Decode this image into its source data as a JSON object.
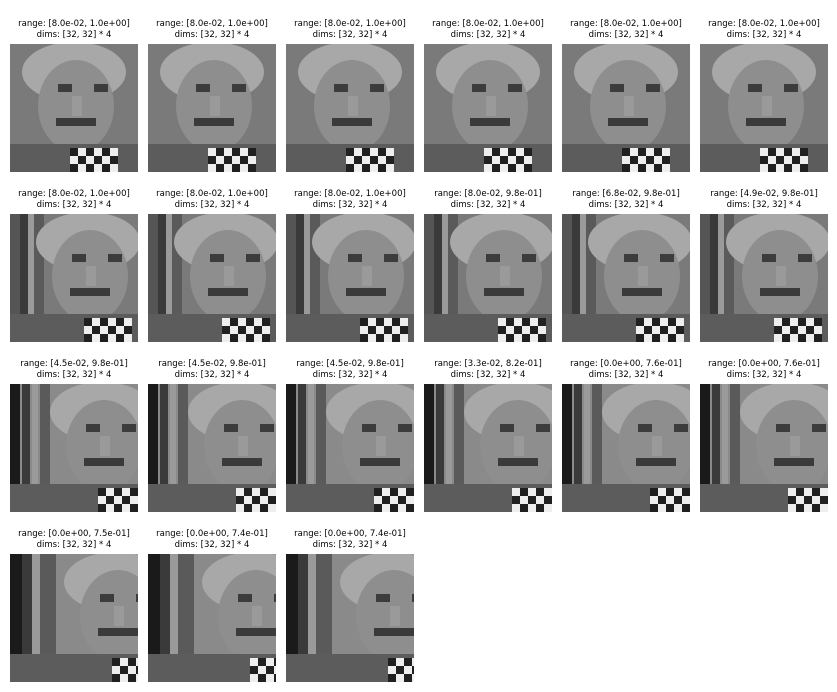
{
  "panels": [
    {
      "range": "range: [8.0e-02, 1.0e+00]",
      "dims": "dims: [32, 32] * 4",
      "shift": 0
    },
    {
      "range": "range: [8.0e-02, 1.0e+00]",
      "dims": "dims: [32, 32] * 4",
      "shift": 0
    },
    {
      "range": "range: [8.0e-02, 1.0e+00]",
      "dims": "dims: [32, 32] * 4",
      "shift": 0
    },
    {
      "range": "range: [8.0e-02, 1.0e+00]",
      "dims": "dims: [32, 32] * 4",
      "shift": 0
    },
    {
      "range": "range: [8.0e-02, 1.0e+00]",
      "dims": "dims: [32, 32] * 4",
      "shift": 0
    },
    {
      "range": "range: [8.0e-02, 1.0e+00]",
      "dims": "dims: [32, 32] * 4",
      "shift": 0
    },
    {
      "range": "range: [8.0e-02, 1.0e+00]",
      "dims": "dims: [32, 32] * 4",
      "shift": 1
    },
    {
      "range": "range: [8.0e-02, 1.0e+00]",
      "dims": "dims: [32, 32] * 4",
      "shift": 1
    },
    {
      "range": "range: [8.0e-02, 1.0e+00]",
      "dims": "dims: [32, 32] * 4",
      "shift": 1
    },
    {
      "range": "range: [8.0e-02, 9.8e-01]",
      "dims": "dims: [32, 32] * 4",
      "shift": 1
    },
    {
      "range": "range: [6.8e-02, 9.8e-01]",
      "dims": "dims: [32, 32] * 4",
      "shift": 1
    },
    {
      "range": "range: [4.9e-02, 9.8e-01]",
      "dims": "dims: [32, 32] * 4",
      "shift": 1
    },
    {
      "range": "range: [4.5e-02, 9.8e-01]",
      "dims": "dims: [32, 32] * 4",
      "shift": 2
    },
    {
      "range": "range: [4.5e-02, 9.8e-01]",
      "dims": "dims: [32, 32] * 4",
      "shift": 2
    },
    {
      "range": "range: [4.5e-02, 9.8e-01]",
      "dims": "dims: [32, 32] * 4",
      "shift": 2
    },
    {
      "range": "range: [3.3e-02, 8.2e-01]",
      "dims": "dims: [32, 32] * 4",
      "shift": 2
    },
    {
      "range": "range: [0.0e+00, 7.6e-01]",
      "dims": "dims: [32, 32] * 4",
      "shift": 2
    },
    {
      "range": "range: [0.0e+00, 7.6e-01]",
      "dims": "dims: [32, 32] * 4",
      "shift": 2
    },
    {
      "range": "range: [0.0e+00, 7.5e-01]",
      "dims": "dims: [32, 32] * 4",
      "shift": 3
    },
    {
      "range": "range: [0.0e+00, 7.4e-01]",
      "dims": "dims: [32, 32] * 4",
      "shift": 3
    },
    {
      "range": "range: [0.0e+00, 7.4e-01]",
      "dims": "dims: [32, 32] * 4",
      "shift": 3
    }
  ]
}
